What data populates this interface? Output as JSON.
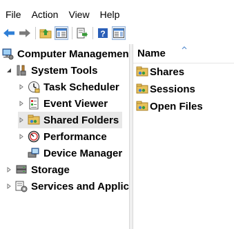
{
  "menubar": {
    "items": [
      "File",
      "Action",
      "View",
      "Help"
    ]
  },
  "toolbar": {
    "buttons": [
      "back-icon",
      "forward-icon",
      "up-folder-icon",
      "show-hide-tree-icon",
      "export-list-icon",
      "help-icon",
      "show-hide-action-pane-icon"
    ]
  },
  "tree": {
    "root": {
      "label": "Computer Management (Local)",
      "icon": "computer-management-icon"
    },
    "system_tools": {
      "label": "System Tools",
      "icon": "tools-icon"
    },
    "task_scheduler": {
      "label": "Task Scheduler",
      "icon": "clock-icon"
    },
    "event_viewer": {
      "label": "Event Viewer",
      "icon": "event-log-icon"
    },
    "shared_folders": {
      "label": "Shared Folders",
      "icon": "shared-folder-icon"
    },
    "performance": {
      "label": "Performance",
      "icon": "performance-gauge-icon"
    },
    "device_manager": {
      "label": "Device Manager",
      "icon": "device-manager-icon"
    },
    "storage": {
      "label": "Storage",
      "icon": "storage-icon"
    },
    "services": {
      "label": "Services and Applications",
      "icon": "services-icon"
    }
  },
  "list": {
    "column_header": "Name",
    "items": [
      "Shares",
      "Sessions",
      "Open Files"
    ]
  },
  "colors": {
    "selection": "#e8e8e8",
    "accent_blue": "#3c7fd4",
    "folder_yellow": "#e8c15a"
  }
}
